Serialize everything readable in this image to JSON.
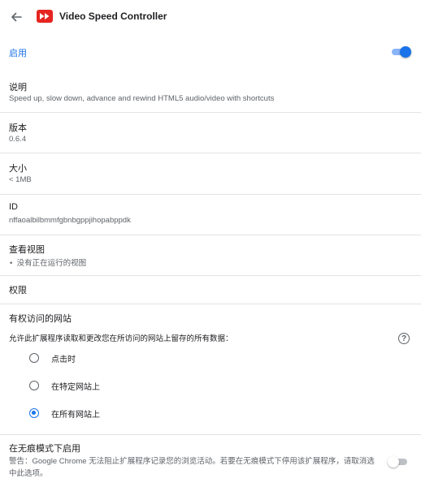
{
  "header": {
    "title": "Video Speed Controller",
    "back_icon": "arrow-left-icon",
    "logo_icon": "fast-forward-logo-icon",
    "logo_color": "#e52521"
  },
  "enable": {
    "label": "启用",
    "state": true
  },
  "description": {
    "label": "说明",
    "value": "Speed up, slow down, advance and rewind HTML5 audio/video with shortcuts"
  },
  "version": {
    "label": "版本",
    "value": "0.6.4"
  },
  "size": {
    "label": "大小",
    "value": "< 1MB"
  },
  "id": {
    "label": "ID",
    "value": "nffaoalbilbmmfgbnbgppjihopabppdk"
  },
  "views": {
    "label": "查看视图",
    "items": [
      "没有正在运行的视图"
    ]
  },
  "permissions": {
    "label": "权限"
  },
  "site_access": {
    "label": "有权访问的网站",
    "prompt": "允许此扩展程序读取和更改您在所访问的网站上留存的所有数据：",
    "help_icon": "help-circle-icon",
    "options": [
      "点击时",
      "在特定网站上",
      "在所有网站上"
    ],
    "selected_index": 2
  },
  "incognito": {
    "label": "在无痕模式下启用",
    "warning": "警告：Google Chrome 无法阻止扩展程序记录您的浏览活动。若要在无痕模式下停用该扩展程序，请取消选中此选项。",
    "state": false
  },
  "colors": {
    "accent": "#1a73e8",
    "divider": "#e3e3e3",
    "secondary_text": "#5f6368"
  }
}
